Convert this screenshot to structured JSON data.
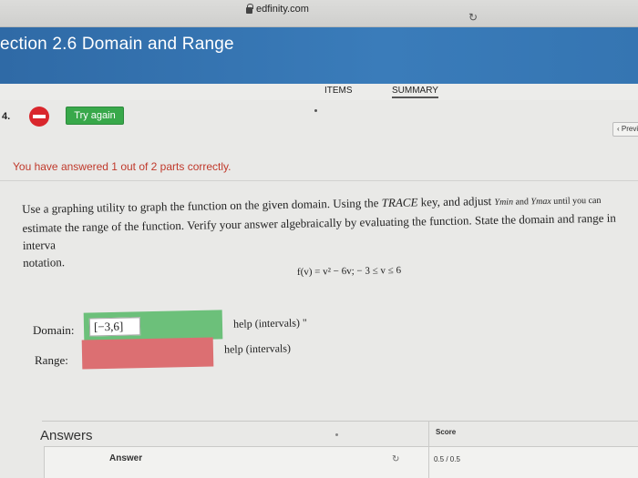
{
  "browser": {
    "url": "edfinity.com"
  },
  "header": {
    "section_title": "ection 2.6 Domain and Range"
  },
  "tabs": [
    {
      "label": "ITEMS"
    },
    {
      "label": "SUMMARY"
    }
  ],
  "question": {
    "number": "4.",
    "try_again": "Try again",
    "prev_label": "‹ Previ",
    "feedback": "You have answered 1 out of 2 parts correctly.",
    "text_line1": "Use a graphing utility to graph the function on the given domain. Using the ",
    "trace": "TRACE",
    "text_line1b": " key, and adjust ",
    "ymin": "Ymin",
    "and": " and ",
    "ymax": "Ymax",
    "until": " until you can",
    "text_line2": "estimate the range of the function. Verify your answer algebraically by evaluating the function. State the domain and range in interva",
    "text_line3": "notation.",
    "formula": "f(v) = v² − 6v;   − 3 ≤ v ≤ 6"
  },
  "domain": {
    "label": "Domain:",
    "value": "[−3,6]",
    "help": "help (intervals) \"",
    "status": "correct",
    "color": "#6cc07a"
  },
  "range": {
    "label": "Range:",
    "value": "",
    "help": "help (intervals)",
    "status": "incorrect",
    "color": "#dc6f72"
  },
  "answers": {
    "title": "Answers",
    "col_answer": "Answer",
    "col_score": "Score",
    "score_value": "0.5 / 0.5"
  }
}
